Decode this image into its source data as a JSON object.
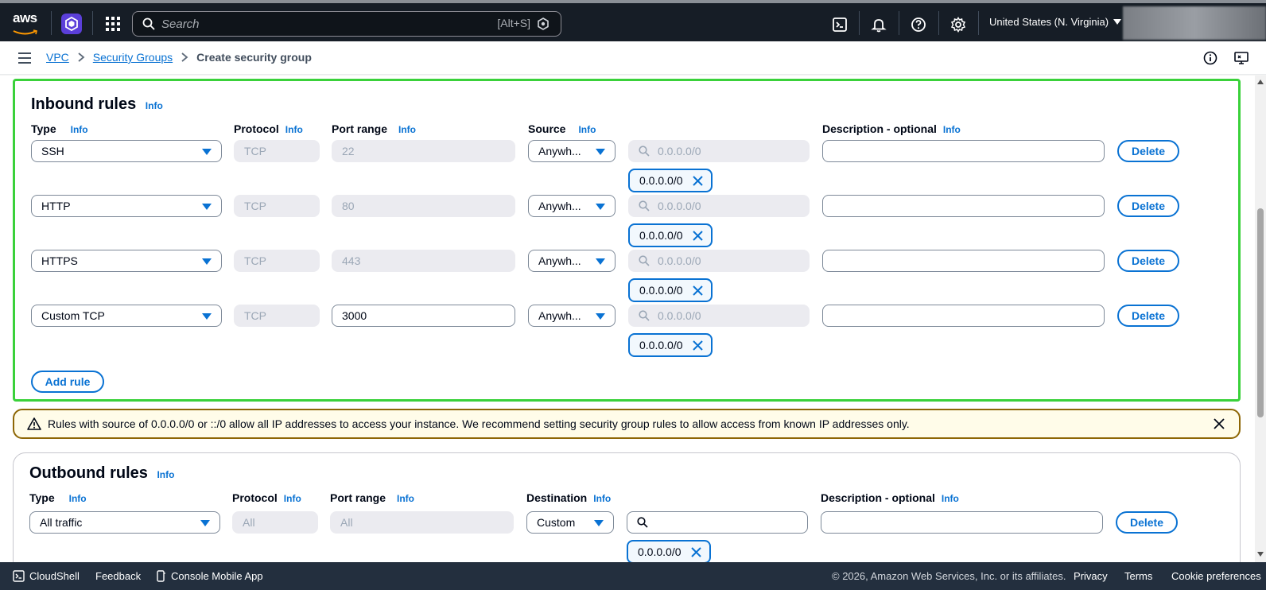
{
  "topnav": {
    "logo_text": "aws",
    "search_placeholder": "Search",
    "search_shortcut": "[Alt+S]",
    "region": "United States (N. Virginia)"
  },
  "breadcrumb": {
    "items": [
      "VPC",
      "Security Groups"
    ],
    "current": "Create security group"
  },
  "inbound": {
    "title": "Inbound rules",
    "info": "Info",
    "columns": {
      "type": "Type",
      "protocol": "Protocol",
      "port_range": "Port range",
      "source": "Source",
      "description": "Description - optional"
    },
    "search_placeholder": "0.0.0.0/0",
    "rules": [
      {
        "type": "SSH",
        "protocol": "TCP",
        "port": "22",
        "port_editable": false,
        "source": "Anywh...",
        "cidr": "0.0.0.0/0",
        "description": "",
        "delete": "Delete"
      },
      {
        "type": "HTTP",
        "protocol": "TCP",
        "port": "80",
        "port_editable": false,
        "source": "Anywh...",
        "cidr": "0.0.0.0/0",
        "description": "",
        "delete": "Delete"
      },
      {
        "type": "HTTPS",
        "protocol": "TCP",
        "port": "443",
        "port_editable": false,
        "source": "Anywh...",
        "cidr": "0.0.0.0/0",
        "description": "",
        "delete": "Delete"
      },
      {
        "type": "Custom TCP",
        "protocol": "TCP",
        "port": "3000",
        "port_editable": true,
        "source": "Anywh...",
        "cidr": "0.0.0.0/0",
        "description": "",
        "delete": "Delete"
      }
    ],
    "add_rule": "Add rule"
  },
  "alert": {
    "message": "Rules with source of 0.0.0.0/0 or ::/0 allow all IP addresses to access your instance. We recommend setting security group rules to allow access from known IP addresses only."
  },
  "outbound": {
    "title": "Outbound rules",
    "info": "Info",
    "columns": {
      "type": "Type",
      "protocol": "Protocol",
      "port_range": "Port range",
      "destination": "Destination",
      "description": "Description - optional"
    },
    "rules": [
      {
        "type": "All traffic",
        "protocol": "All",
        "port": "All",
        "destination": "Custom",
        "cidr": "0.0.0.0/0",
        "description": "",
        "delete": "Delete"
      }
    ]
  },
  "footer": {
    "cloudshell": "CloudShell",
    "feedback": "Feedback",
    "mobile_app": "Console Mobile App",
    "copyright": "© 2026, Amazon Web Services, Inc. or its affiliates.",
    "privacy": "Privacy",
    "terms": "Terms",
    "cookies": "Cookie preferences"
  },
  "colors": {
    "nav_bg": "#161d26",
    "link_blue": "#0972d3",
    "highlight_green": "#3ad13a",
    "warning_border": "#8d6605",
    "footer_bg": "#232f3e"
  }
}
